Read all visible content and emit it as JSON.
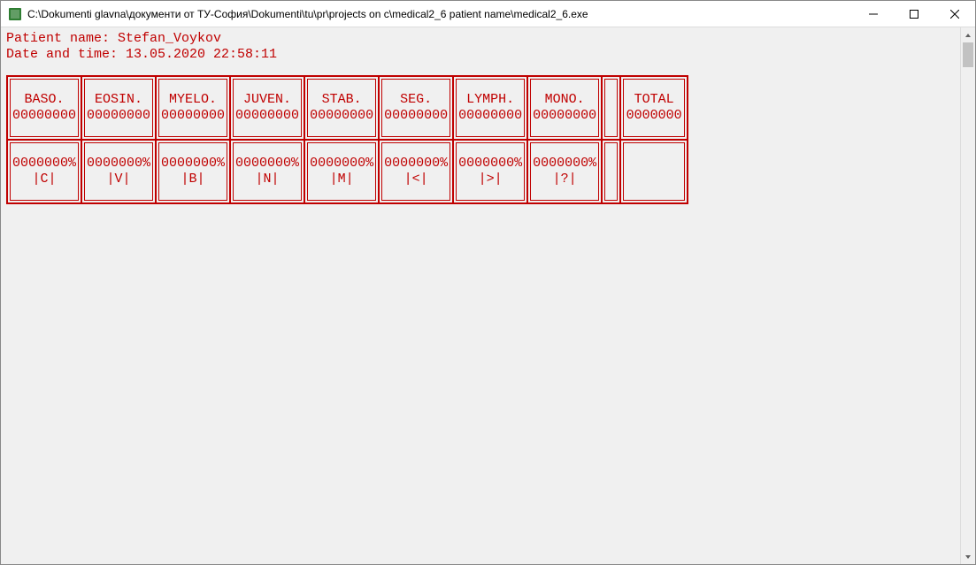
{
  "window": {
    "title": "C:\\Dokumenti glavna\\документи от ТУ-София\\Dokumenti\\tu\\pr\\projects on c\\medical2_6 patient name\\medical2_6.exe"
  },
  "header": {
    "patient_label": "Patient name: ",
    "patient_value": "Stefan_Voykov",
    "datetime_label": "Date and time: ",
    "datetime_value": "13.05.2020 22:58:11"
  },
  "columns": [
    {
      "name": "BASO.",
      "count": "00000000",
      "pct": "0000000%",
      "key": "|C|"
    },
    {
      "name": "EOSIN.",
      "count": "00000000",
      "pct": "0000000%",
      "key": "|V|"
    },
    {
      "name": "MYELO.",
      "count": "00000000",
      "pct": "0000000%",
      "key": "|B|"
    },
    {
      "name": "JUVEN.",
      "count": "00000000",
      "pct": "0000000%",
      "key": "|N|"
    },
    {
      "name": "STAB.",
      "count": "00000000",
      "pct": "0000000%",
      "key": "|M|"
    },
    {
      "name": "SEG.",
      "count": "00000000",
      "pct": "0000000%",
      "key": "|<|"
    },
    {
      "name": "LYMPH.",
      "count": "00000000",
      "pct": "0000000%",
      "key": "|>|"
    },
    {
      "name": "MONO.",
      "count": "00000000",
      "pct": "0000000%",
      "key": "|?|"
    }
  ],
  "total": {
    "label": "TOTAL",
    "value": "0000000"
  }
}
